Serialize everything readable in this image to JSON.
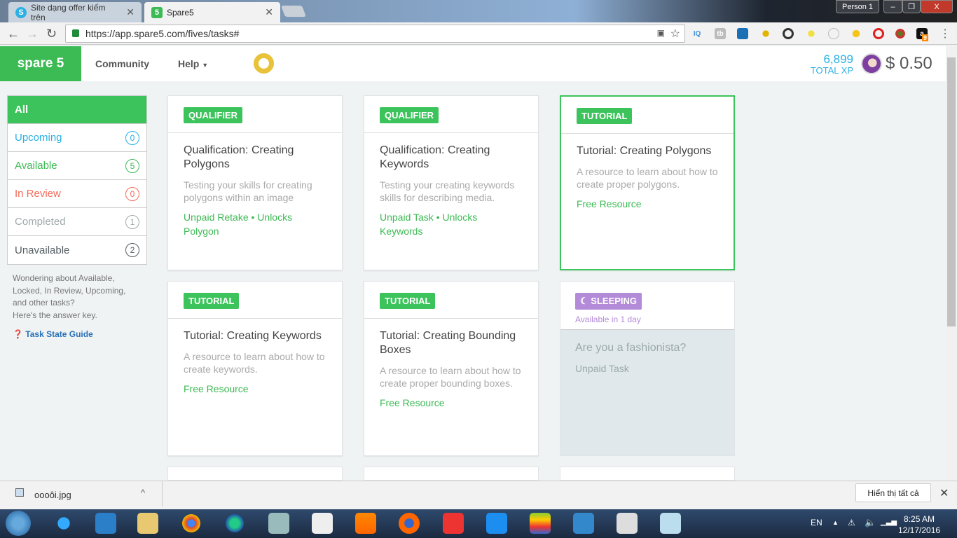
{
  "browser": {
    "tabs": [
      {
        "title": "Site dạng offer kiếm trên"
      },
      {
        "title": "Spare5"
      }
    ],
    "url": "https://app.spare5.com/fives/tasks#",
    "profile": "Person 1",
    "amazon_badge": "9"
  },
  "header": {
    "logo": "spare 5",
    "nav": [
      "Community",
      "Help"
    ],
    "xp_value": "6,899",
    "xp_label": "TOTAL XP",
    "balance": "$ 0.50"
  },
  "sidebar": {
    "items": [
      {
        "label": "All",
        "count": null,
        "color": "#ffffff"
      },
      {
        "label": "Upcoming",
        "count": "0",
        "color": "#2ab0e5"
      },
      {
        "label": "Available",
        "count": "5",
        "color": "#3cba54"
      },
      {
        "label": "In Review",
        "count": "0",
        "color": "#f26b5b"
      },
      {
        "label": "Completed",
        "count": "1",
        "color": "#a0aaaa"
      },
      {
        "label": "Unavailable",
        "count": "2",
        "color": "#555e63"
      }
    ],
    "help_text": "Wondering about Available, Locked, In Review, Upcoming, and other tasks?",
    "help_text2": "Here's the answer key.",
    "guide_link": "Task State Guide"
  },
  "cards": [
    {
      "tag": "QUALIFIER",
      "title": "Qualification: Creating Polygons",
      "desc": "Testing your skills for creating polygons within an image",
      "footer": "Unpaid Retake • Unlocks Polygon"
    },
    {
      "tag": "QUALIFIER",
      "title": "Qualification: Creating Keywords",
      "desc": "Testing your creating keywords skills for describing media.",
      "footer": "Unpaid Task • Unlocks Keywords"
    },
    {
      "tag": "TUTORIAL",
      "title": "Tutorial: Creating Polygons",
      "desc": "A resource to learn about how to create proper polygons.",
      "footer": "Free Resource"
    },
    {
      "tag": "TUTORIAL",
      "title": "Tutorial: Creating Keywords",
      "desc": "A resource to learn about how to create keywords.",
      "footer": "Free Resource"
    },
    {
      "tag": "TUTORIAL",
      "title": "Tutorial: Creating Bounding Boxes",
      "desc": "A resource to learn about how to create proper bounding boxes.",
      "footer": "Free Resource"
    }
  ],
  "sleeping": {
    "tag": "SLEEPING",
    "available": "Available in 1 day",
    "title": "Are you a fashionista?",
    "footer": "Unpaid Task"
  },
  "download": {
    "file": "oooôi.jpg",
    "show_all": "Hiển thị tất cả"
  },
  "taskbar": {
    "lang": "EN",
    "time": "8:25 AM",
    "date": "12/17/2016"
  }
}
